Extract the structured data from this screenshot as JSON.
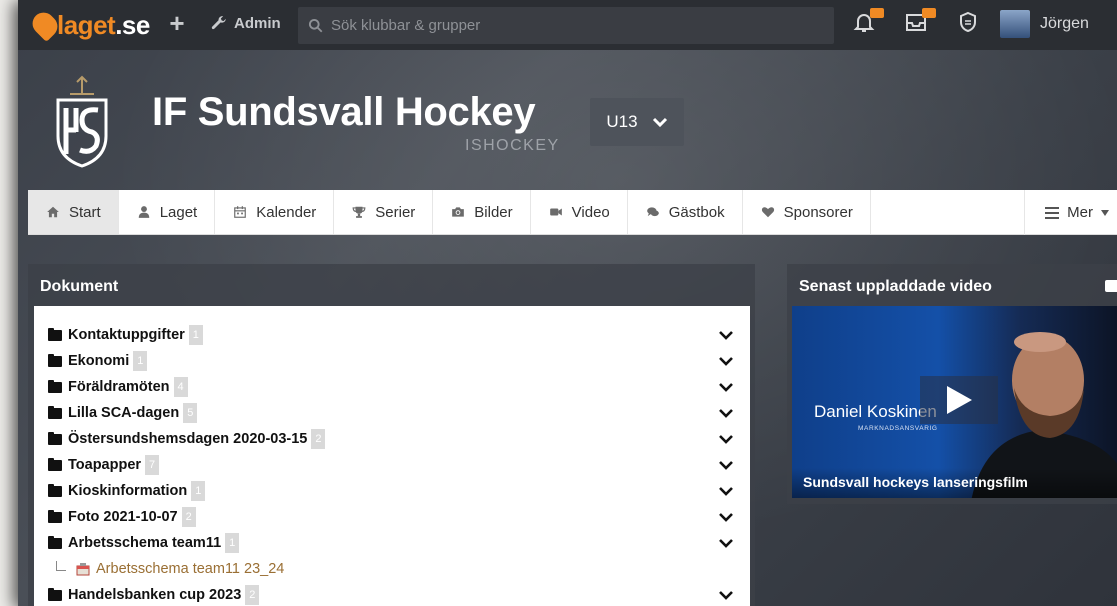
{
  "topbar": {
    "logo_main": "laget",
    "logo_dot": ".se",
    "admin_label": "Admin",
    "search_placeholder": "Sök klubbar & grupper",
    "user_name": "Jörgen"
  },
  "club": {
    "name": "IF Sundsvall Hockey",
    "sport": "ISHOCKEY",
    "team": "U13"
  },
  "nav": {
    "items": [
      {
        "label": "Start",
        "icon": "home-icon"
      },
      {
        "label": "Laget",
        "icon": "user-icon"
      },
      {
        "label": "Kalender",
        "icon": "calendar-icon"
      },
      {
        "label": "Serier",
        "icon": "trophy-icon"
      },
      {
        "label": "Bilder",
        "icon": "camera-icon"
      },
      {
        "label": "Video",
        "icon": "video-icon"
      },
      {
        "label": "Gästbok",
        "icon": "chat-icon"
      },
      {
        "label": "Sponsorer",
        "icon": "heart-icon"
      }
    ],
    "more_label": "Mer"
  },
  "documents": {
    "title": "Dokument",
    "folders": [
      {
        "name": "Kontaktuppgifter",
        "count": "1"
      },
      {
        "name": "Ekonomi",
        "count": "1"
      },
      {
        "name": "Föräldramöten",
        "count": "4"
      },
      {
        "name": "Lilla SCA-dagen",
        "count": "5"
      },
      {
        "name": "Östersundshemsdagen 2020-03-15",
        "count": "2"
      },
      {
        "name": "Toapapper",
        "count": "7"
      },
      {
        "name": "Kioskinformation",
        "count": "1"
      },
      {
        "name": "Foto 2021-10-07",
        "count": "2"
      },
      {
        "name": "Arbetsschema team11",
        "count": "1"
      },
      {
        "name": "Handelsbanken cup 2023",
        "count": "2"
      }
    ],
    "expanded_file": "Arbetsschema team11 23_24"
  },
  "video": {
    "title": "Senast uppladdade video",
    "person_name": "Daniel Koskinen",
    "person_role": "MARKNADSANSVARIG",
    "caption": "Sundsvall hockeys lanseringsfilm"
  },
  "colors": {
    "accent": "#f08a24",
    "link": "#9a6f34",
    "topbar": "#2b2e33"
  }
}
